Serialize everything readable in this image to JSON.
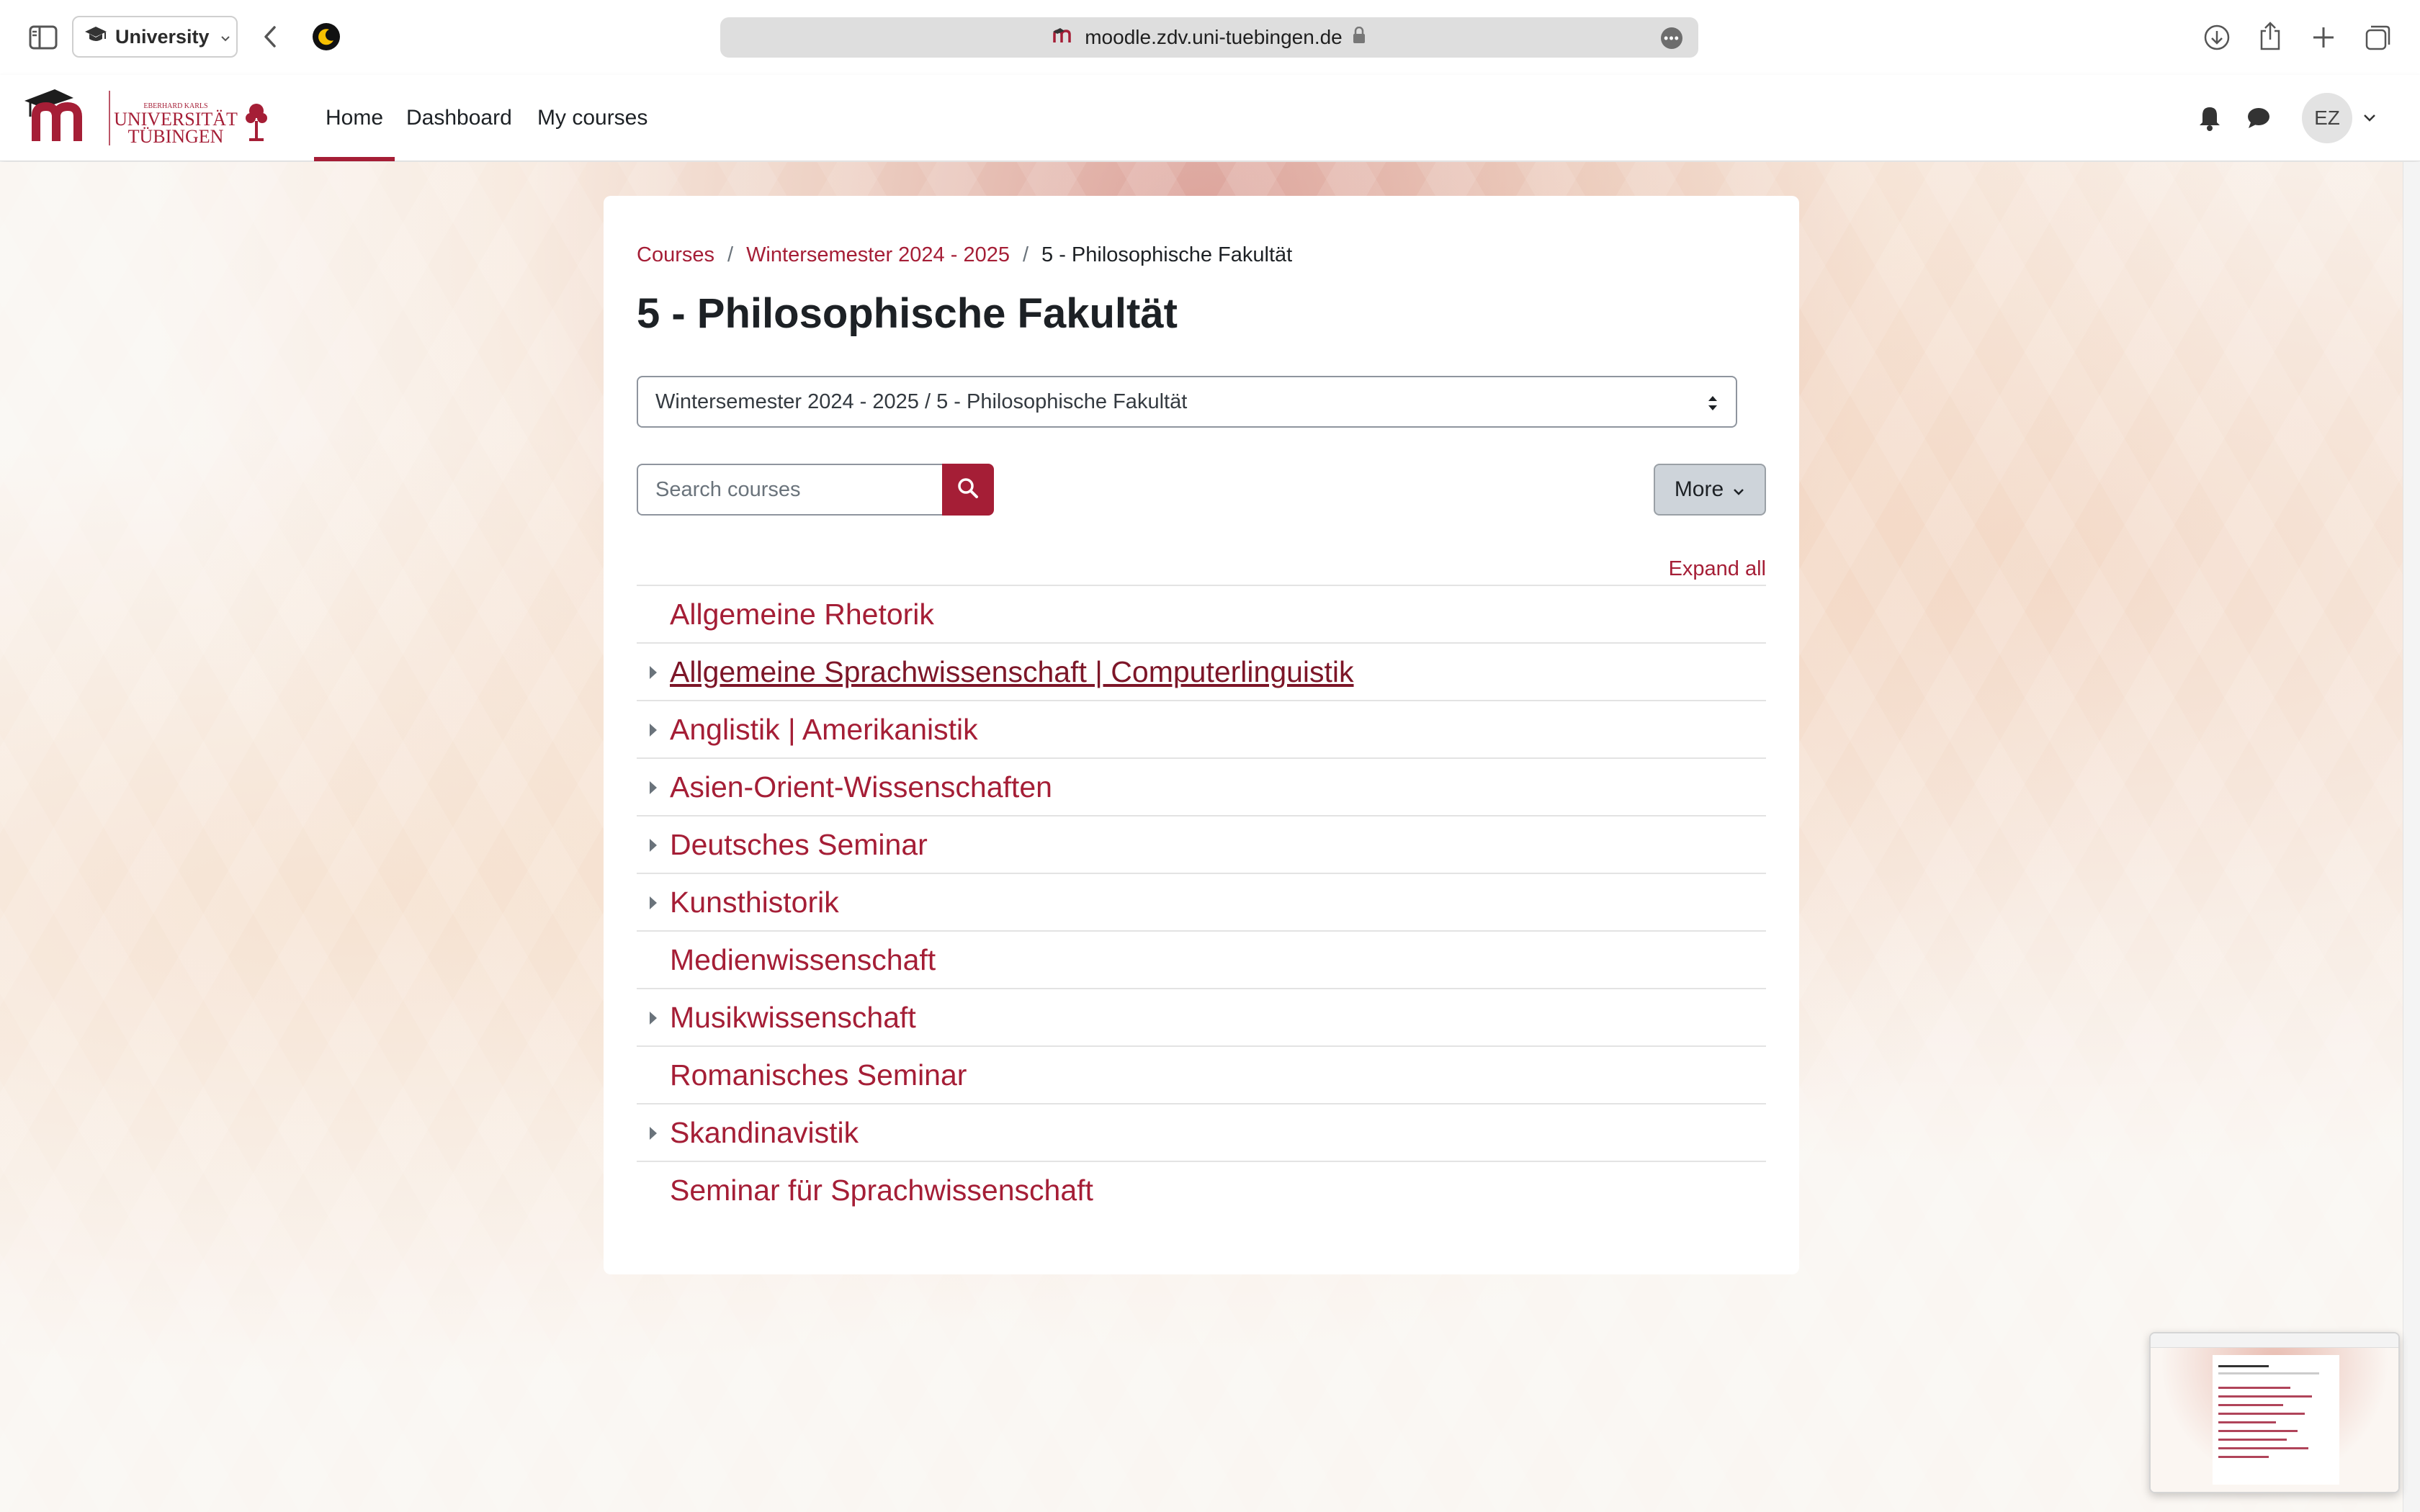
{
  "browser": {
    "profile_label": "University",
    "url": "moodle.zdv.uni-tuebingen.de"
  },
  "nav": {
    "home": "Home",
    "dashboard": "Dashboard",
    "my_courses": "My courses",
    "avatar_initials": "EZ"
  },
  "logo": {
    "line1": "EBERHARD KARLS",
    "line2": "UNIVERSITÄT",
    "line3": "TÜBINGEN"
  },
  "breadcrumb": {
    "courses": "Courses",
    "semester": "Wintersemester 2024 - 2025",
    "current": "5 - Philosophische Fakultät"
  },
  "page": {
    "title": "5 - Philosophische Fakultät",
    "category_select": "Wintersemester 2024 - 2025 / 5 - Philosophische Fakultät",
    "search_placeholder": "Search courses",
    "more_label": "More",
    "expand_all": "Expand all"
  },
  "categories": [
    {
      "name": "Allgemeine Rhetorik",
      "expandable": false
    },
    {
      "name": "Allgemeine Sprachwissenschaft | Computerlinguistik",
      "expandable": true
    },
    {
      "name": "Anglistik | Amerikanistik",
      "expandable": true
    },
    {
      "name": "Asien-Orient-Wissenschaften",
      "expandable": true
    },
    {
      "name": "Deutsches Seminar",
      "expandable": true
    },
    {
      "name": "Kunsthistorik",
      "expandable": true
    },
    {
      "name": "Medienwissenschaft",
      "expandable": false
    },
    {
      "name": "Musikwissenschaft",
      "expandable": true
    },
    {
      "name": "Romanisches Seminar",
      "expandable": false
    },
    {
      "name": "Skandinavistik",
      "expandable": true
    },
    {
      "name": "Seminar für Sprachwissenschaft",
      "expandable": false
    }
  ],
  "colors": {
    "brand": "#a51e36",
    "text": "#1d2125"
  }
}
